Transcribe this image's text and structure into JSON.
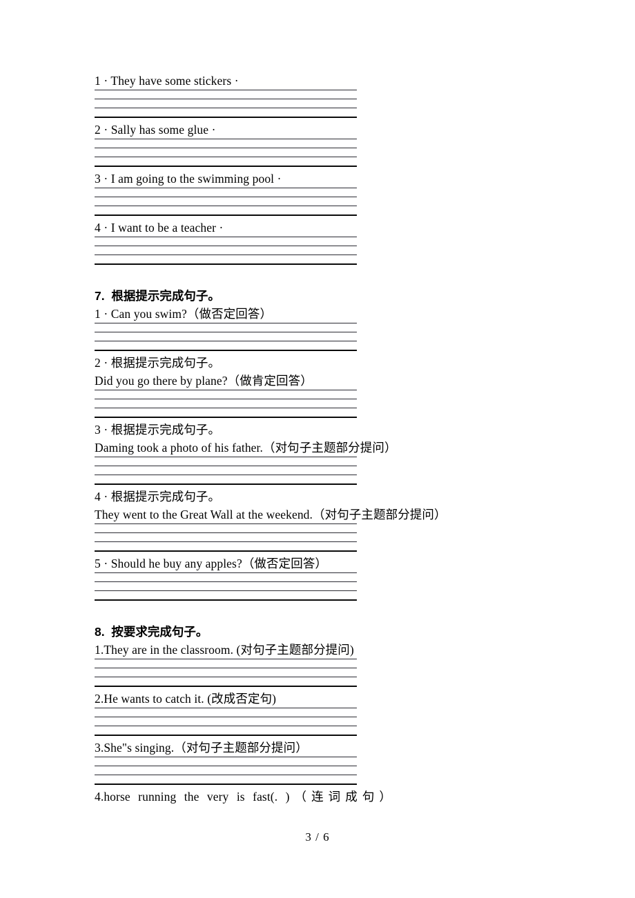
{
  "document": {
    "page_label": "3 / 6"
  },
  "top_block": {
    "items": [
      {
        "text": "1 · They have some stickers ·"
      },
      {
        "text": "2 · Sally has some glue ·"
      },
      {
        "text": "3 · I am going to the swimming pool ·"
      },
      {
        "text": "4 · I want to be a teacher ·"
      }
    ]
  },
  "section7": {
    "heading": "7.  根据提示完成句子。",
    "items": [
      {
        "lines": [
          "1 · Can you swim?（做否定回答）"
        ]
      },
      {
        "lines": [
          "2 · 根据提示完成句子。",
          "Did you go there by plane?（做肯定回答）"
        ]
      },
      {
        "lines": [
          "3 · 根据提示完成句子。",
          "Daming took a photo of his father.（对句子主题部分提问）"
        ]
      },
      {
        "lines": [
          "4 · 根据提示完成句子。",
          "They went to the Great Wall at the weekend.（对句子主题部分提问）"
        ]
      },
      {
        "lines": [
          "5 · Should he buy any apples?（做否定回答）"
        ]
      }
    ]
  },
  "section8": {
    "heading": "8.  按要求完成句子。",
    "items": [
      {
        "lines": [
          "1.They are in the classroom. (对句子主题部分提问)"
        ]
      },
      {
        "lines": [
          "2.He wants to catch it. (改成否定句)"
        ]
      },
      {
        "lines": [
          "3.She\"s singing.（对句子主题部分提问）"
        ]
      }
    ],
    "last_item": "4.horse running the very is fast(. )（连词成句）"
  }
}
